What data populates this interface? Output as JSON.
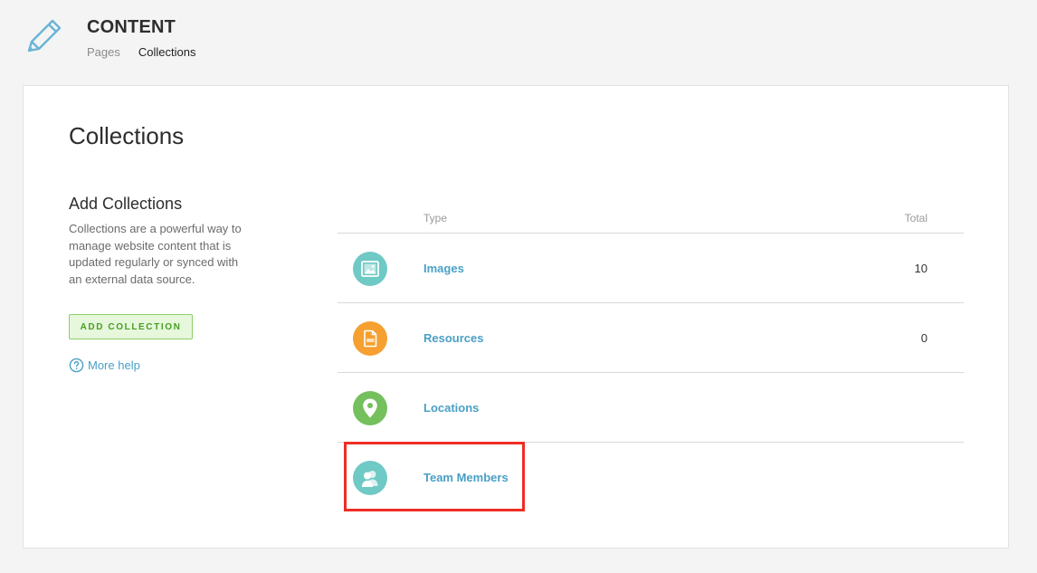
{
  "header": {
    "title": "CONTENT",
    "icon": "pencil-icon",
    "tabs": [
      {
        "label": "Pages",
        "active": false
      },
      {
        "label": "Collections",
        "active": true
      }
    ]
  },
  "main": {
    "title": "Collections",
    "side": {
      "title": "Add Collections",
      "description": "Collections are a powerful way to manage website content that is updated regularly or synced with an external data source.",
      "add_button": "ADD COLLECTION",
      "more_help": "More help"
    },
    "table": {
      "columns": {
        "type": "Type",
        "total": "Total"
      },
      "rows": [
        {
          "name": "Images",
          "total": "10",
          "icon": "image-icon",
          "color": "#6fc9c5"
        },
        {
          "name": "Resources",
          "total": "0",
          "icon": "pdf-icon",
          "color": "#f5a030"
        },
        {
          "name": "Locations",
          "total": "",
          "icon": "location-pin-icon",
          "color": "#74c05d"
        },
        {
          "name": "Team Members",
          "total": "",
          "icon": "team-members-icon",
          "color": "#6fc9c5"
        }
      ]
    }
  },
  "colors": {
    "accent": "#4aa0c6",
    "button_green": "#4a9e24",
    "highlight_red": "#ee2d25"
  }
}
